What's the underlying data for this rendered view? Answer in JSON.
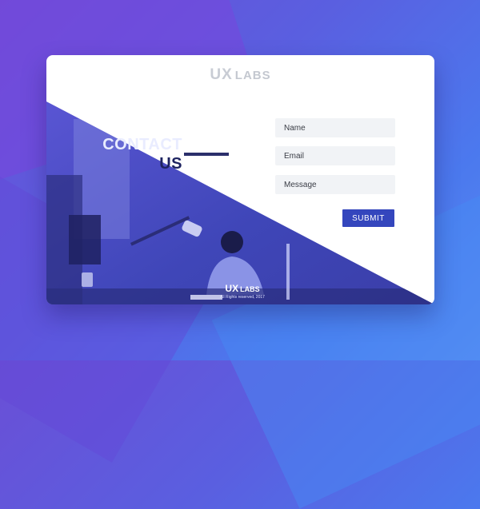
{
  "brand": {
    "mark": "UX",
    "name": "LABS"
  },
  "contact": {
    "title_line1": "CONTACT",
    "title_line2": "US"
  },
  "form": {
    "name_placeholder": "Name",
    "email_placeholder": "Email",
    "message_placeholder": "Message",
    "submit_label": "SUBMIT"
  },
  "footer": {
    "mark": "UX",
    "name": "LABS",
    "copyright": "All Rights reserved, 2017"
  },
  "colors": {
    "accent": "#3446bd",
    "title_dark": "#1d2360",
    "field_bg": "#f1f3f6"
  }
}
